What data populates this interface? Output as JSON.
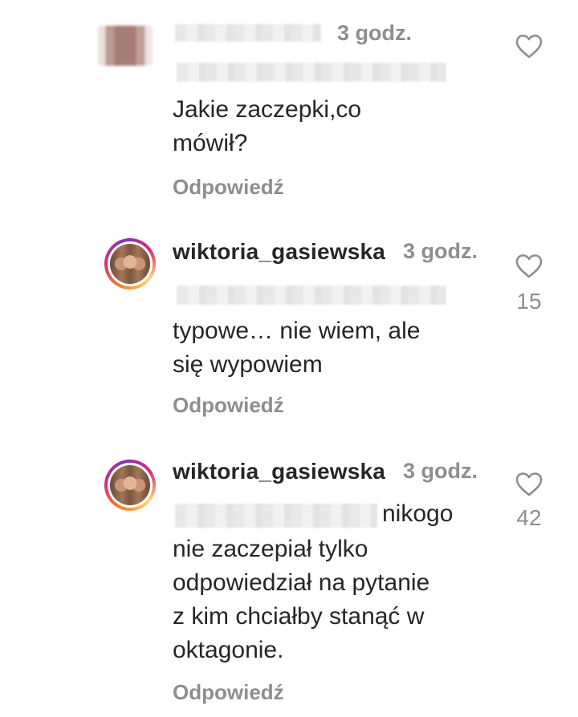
{
  "comments": [
    {
      "username": "",
      "time": "3 godz.",
      "text": "Jakie zaczepki,co\nmówił?",
      "reply_label": "Odpowiedź",
      "likes": ""
    },
    {
      "username": "wiktoria_gasiewska",
      "time": "3 godz.",
      "text": "typowe… nie wiem, ale\nsię wypowiem",
      "reply_label": "Odpowiedź",
      "likes": "15"
    },
    {
      "username": "wiktoria_gasiewska",
      "time": "3 godz.",
      "text_first_line": "nikogo",
      "text": "nie zaczepiał tylko\nodpowiedział na pytanie\nz kim chciałby stanąć w\noktagonie.",
      "reply_label": "Odpowiedź",
      "likes": "42"
    }
  ],
  "icons": {
    "like": "heart-outline-icon"
  },
  "colors": {
    "text": "#262626",
    "muted": "#8e8e8e"
  }
}
